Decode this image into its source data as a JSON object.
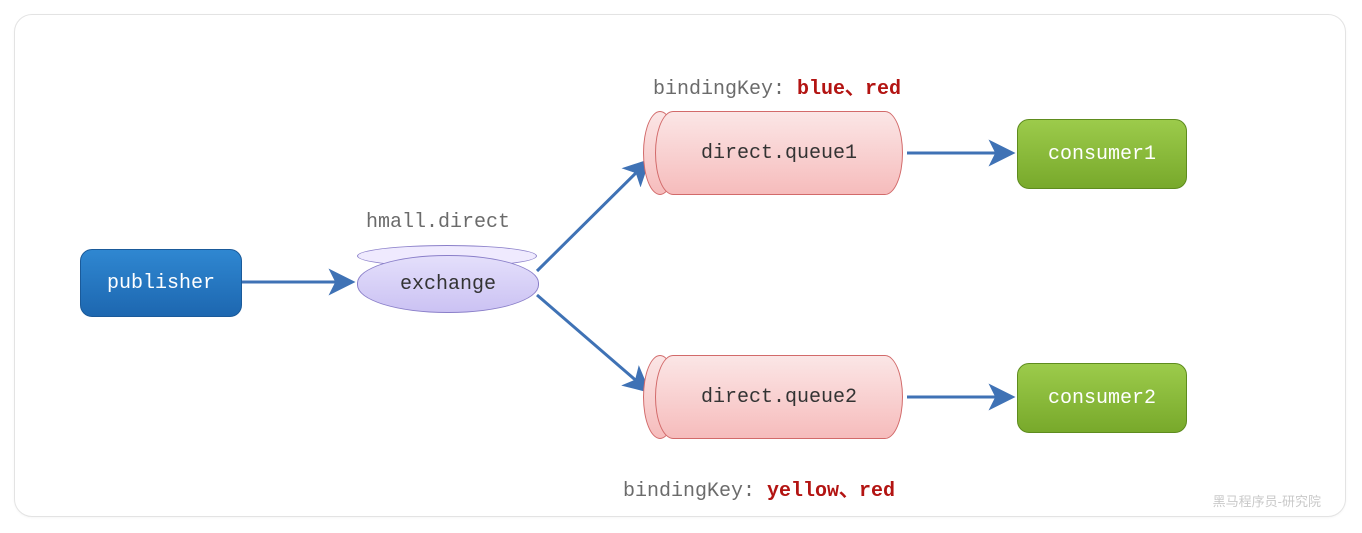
{
  "publisher": {
    "label": "publisher"
  },
  "exchange": {
    "label": "exchange",
    "name": "hmall.direct"
  },
  "queues": {
    "q1": {
      "label": "direct.queue1",
      "binding_key_label": "bindingKey: ",
      "binding_keys": "blue、red"
    },
    "q2": {
      "label": "direct.queue2",
      "binding_key_label": "bindingKey: ",
      "binding_keys": "yellow、red"
    }
  },
  "consumers": {
    "c1": {
      "label": "consumer1"
    },
    "c2": {
      "label": "consumer2"
    }
  },
  "watermark": "黑马程序员-研究院",
  "colors": {
    "arrow": "#3f72b5",
    "publisher": "#2577c1",
    "exchange": "#d7cff7",
    "queue": "#f6caca",
    "consumer": "#8ebf3a"
  }
}
